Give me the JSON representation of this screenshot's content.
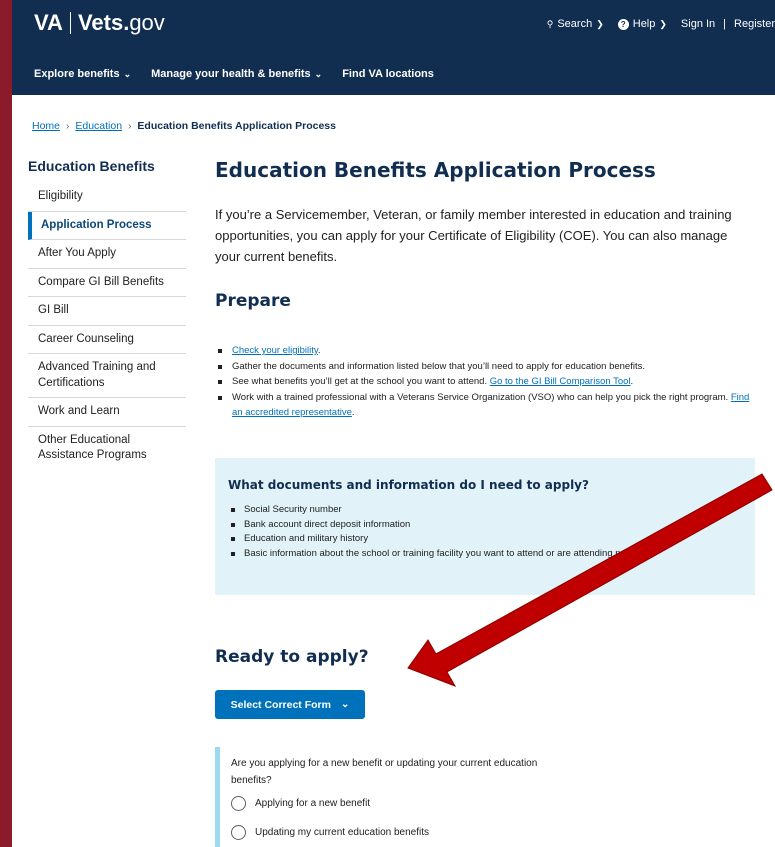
{
  "header": {
    "logo_va": "VA",
    "logo_vets": "Vets.",
    "logo_gov": "gov",
    "search_label": "Search",
    "help_label": "Help",
    "sign_in": "Sign In",
    "divider": "|",
    "register": "Register",
    "nav": [
      {
        "label": "Explore benefits"
      },
      {
        "label": "Manage your health & benefits"
      },
      {
        "label": "Find VA locations"
      }
    ]
  },
  "breadcrumb": {
    "home": "Home",
    "education": "Education",
    "current": "Education Benefits Application Process"
  },
  "sidebar": {
    "title": "Education Benefits",
    "items": [
      {
        "label": "Eligibility"
      },
      {
        "label": "Application Process"
      },
      {
        "label": "After You Apply"
      },
      {
        "label": "Compare GI Bill Benefits"
      },
      {
        "label": "GI Bill"
      },
      {
        "label": "Career Counseling"
      },
      {
        "label": "Advanced Training and Certifications"
      },
      {
        "label": "Work and Learn"
      },
      {
        "label": "Other Educational Assistance Programs"
      }
    ]
  },
  "main": {
    "title": "Education Benefits Application Process",
    "intro": "If you’re a Servicemember, Veteran, or family member interested in education and training opportunities, you can apply for your Certificate of Eligibility (COE). You can also manage your current benefits.",
    "prepare_heading": "Prepare",
    "prepare_items": {
      "item1_link": "Check your eligibility",
      "item1_tail": ".",
      "item2": "Gather the documents and information listed below that you’ll need to apply for education benefits.",
      "item3_text": "See what benefits you’ll get at the school you want to attend. ",
      "item3_link": "Go to the GI Bill Comparison Tool",
      "item3_tail": ".",
      "item4_text": "Work with a trained professional with a Veterans Service Organization (VSO) who can help you pick the right program. ",
      "item4_link": "Find an accredited representative",
      "item4_tail": "."
    },
    "docs_box": {
      "title": "What documents and information do I need to apply?",
      "items": [
        "Social Security number",
        "Bank account direct deposit information",
        "Education and military history",
        "Basic information about the school or training facility you want to attend or are attending now"
      ]
    },
    "ready_heading": "Ready to apply?",
    "select_button": "Select Correct Form",
    "question": "Are you applying for a new benefit or updating your current education benefits?",
    "options": [
      {
        "label": "Applying for a new benefit"
      },
      {
        "label": "Updating my current education benefits"
      }
    ]
  },
  "colors": {
    "header_bg": "#112e51",
    "link": "#0071bb",
    "outer_frame": "#8b1a2b",
    "info_box_bg": "#e1f3f8",
    "arrow": "#c00000"
  }
}
